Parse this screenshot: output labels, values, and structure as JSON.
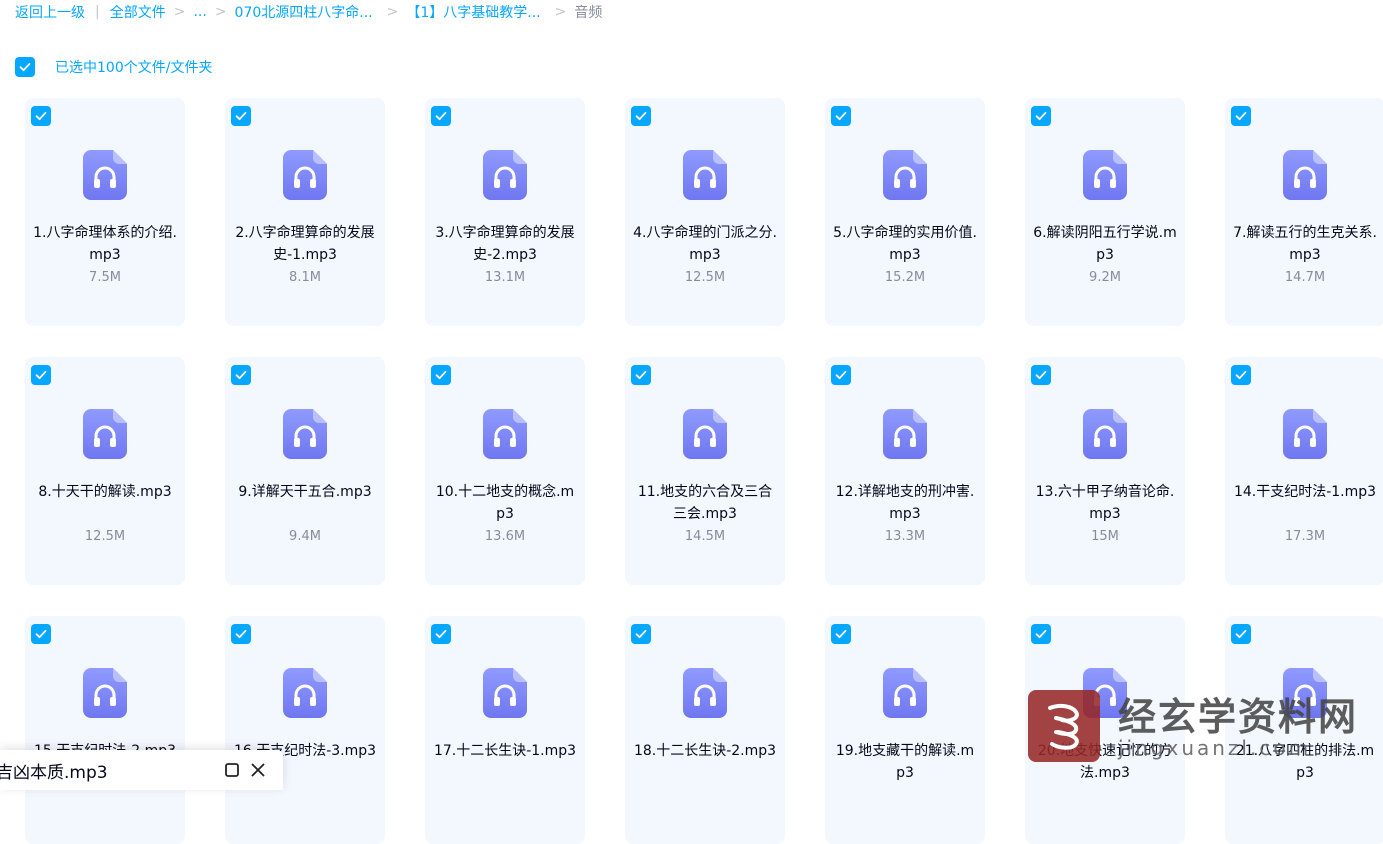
{
  "breadcrumb": {
    "back": "返回上一级",
    "all_files": "全部文件",
    "ellipsis": "...",
    "folder1": "070北源四柱八字命...",
    "folder2": "【1】八字基础教学...",
    "current": "音频"
  },
  "selection": {
    "label": "已选中100个文件/文件夹",
    "checked": true
  },
  "accent_color": "#06a7ff",
  "icon_color": "#7b85f5",
  "files": [
    {
      "name": "1.八字命理体系的介绍.mp3",
      "size": "7.5M"
    },
    {
      "name": "2.八字命理算命的发展史-1.mp3",
      "size": "8.1M"
    },
    {
      "name": "3.八字命理算命的发展史-2.mp3",
      "size": "13.1M"
    },
    {
      "name": "4.八字命理的门派之分.mp3",
      "size": "12.5M"
    },
    {
      "name": "5.八字命理的实用价值.mp3",
      "size": "15.2M"
    },
    {
      "name": "6.解读阴阳五行学说.mp3",
      "size": "9.2M"
    },
    {
      "name": "7.解读五行的生克关系.mp3",
      "size": "14.7M"
    },
    {
      "name": "8.十天干的解读.mp3",
      "size": "12.5M"
    },
    {
      "name": "9.详解天干五合.mp3",
      "size": "9.4M"
    },
    {
      "name": "10.十二地支的概念.mp3",
      "size": "13.6M"
    },
    {
      "name": "11.地支的六合及三合三会.mp3",
      "size": "14.5M"
    },
    {
      "name": "12.详解地支的刑冲害.mp3",
      "size": "13.3M"
    },
    {
      "name": "13.六十甲子纳音论命.mp3",
      "size": "15M"
    },
    {
      "name": "14.干支纪时法-1.mp3",
      "size": "17.3M"
    },
    {
      "name": "15.干支纪时法-2.mp3",
      "size": ""
    },
    {
      "name": "16.干支纪时法-3.mp3",
      "size": ""
    },
    {
      "name": "17.十二长生诀-1.mp3",
      "size": ""
    },
    {
      "name": "18.十二长生诀-2.mp3",
      "size": ""
    },
    {
      "name": "19.地支藏干的解读.mp3",
      "size": ""
    },
    {
      "name": "20.地支快速记忆的方法.mp3",
      "size": ""
    },
    {
      "name": "21.八字四柱的排法.mp3",
      "size": ""
    }
  ],
  "player": {
    "title": "吉凶本质.mp3",
    "window_icon": "window-icon",
    "close_icon": "close-icon"
  },
  "watermark": {
    "main": "经玄学资料网",
    "sub": "jingxuanzl.com"
  }
}
